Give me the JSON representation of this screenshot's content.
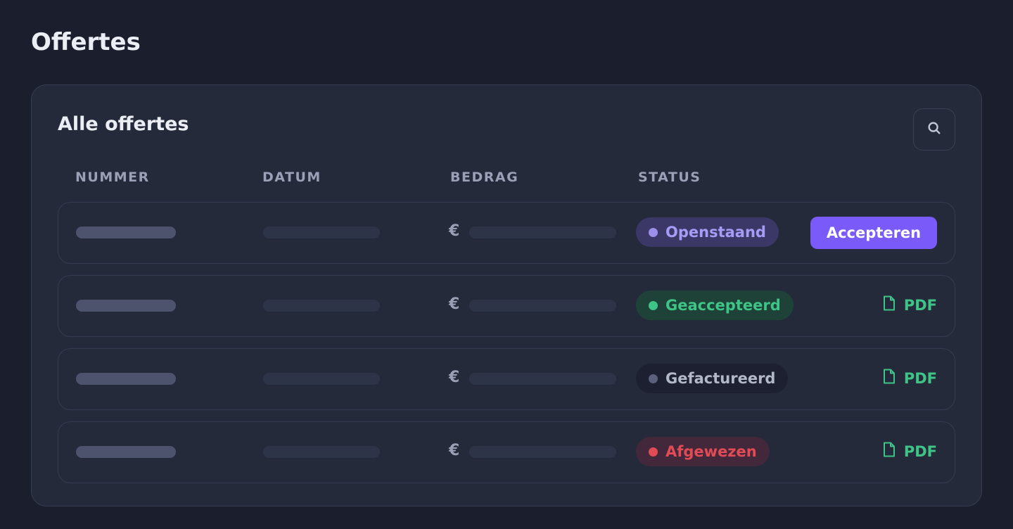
{
  "page": {
    "title": "Offertes"
  },
  "card": {
    "title": "Alle offertes"
  },
  "columns": [
    "NUMMER",
    "DATUM",
    "BEDRAG",
    "STATUS"
  ],
  "currency_symbol": "€",
  "rows": [
    {
      "status": "Openstaand",
      "status_color": "#a79cf5",
      "badge_bg": "#3b3868",
      "dot_color": "#9b8fe8",
      "action": "Accepteren",
      "action_type": "button"
    },
    {
      "status": "Geaccepteerd",
      "status_color": "#3ec486",
      "badge_bg": "#1f4238",
      "dot_color": "#3ec486",
      "action": "PDF",
      "action_type": "pdf"
    },
    {
      "status": "Gefactureerd",
      "status_color": "#b3b8c8",
      "badge_bg": "#1c2030",
      "dot_color": "#5b6178",
      "action": "PDF",
      "action_type": "pdf"
    },
    {
      "status": "Afgewezen",
      "status_color": "#e04b55",
      "badge_bg": "#42283a",
      "dot_color": "#e04b55",
      "action": "PDF",
      "action_type": "pdf"
    }
  ],
  "icons": {
    "search": "search-icon",
    "pdf": "file-icon"
  },
  "colors": {
    "accent": "#7a5af8",
    "success": "#3ec486",
    "danger": "#e04b55",
    "background": "#1b1f2d",
    "card": "#252a3b"
  }
}
